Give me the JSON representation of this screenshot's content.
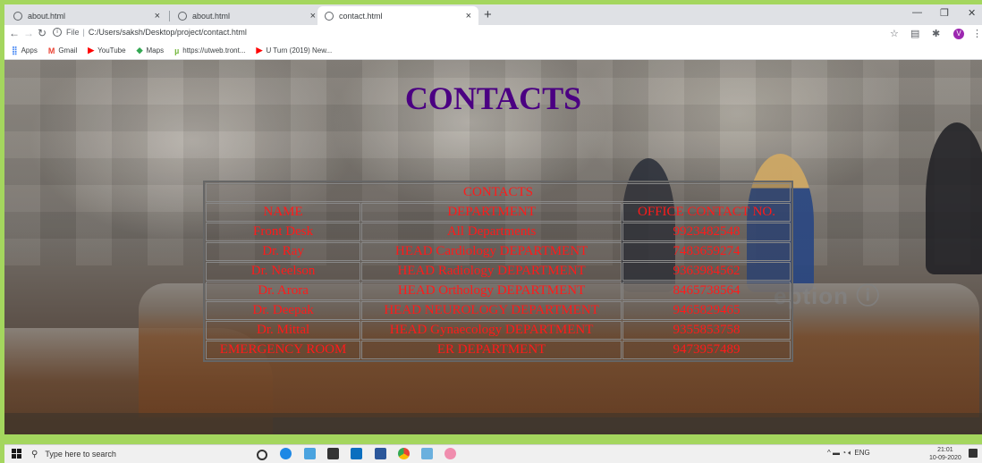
{
  "browser": {
    "tabs": [
      {
        "title": "about.html",
        "active": false
      },
      {
        "title": "about.html",
        "active": false
      },
      {
        "title": "contact.html",
        "active": true
      }
    ],
    "new_tab_symbol": "+",
    "close_symbol": "×",
    "address": {
      "scheme_label": "File",
      "url": "C:/Users/saksh/Desktop/project/contact.html"
    },
    "bookmarks": [
      {
        "label": "Apps",
        "icon": "apps-grid-icon",
        "color": "#4285f4"
      },
      {
        "label": "Gmail",
        "icon": "gmail-icon",
        "color": "#ea4335"
      },
      {
        "label": "YouTube",
        "icon": "youtube-icon",
        "color": "#ff0000"
      },
      {
        "label": "Maps",
        "icon": "maps-icon",
        "color": "#34a853"
      },
      {
        "label": "https://utweb.tront...",
        "icon": "utorrent-icon",
        "color": "#76b83f"
      },
      {
        "label": "U Turn (2019) New...",
        "icon": "youtube-icon",
        "color": "#ff0000"
      }
    ],
    "profile_initial": "V"
  },
  "page": {
    "title": "CONTACTS",
    "table": {
      "caption": "CONTACTS",
      "headers": [
        "NAME",
        "DEPARTMENT",
        "OFFICE CONTACT NO."
      ],
      "rows": [
        [
          "Front Desk",
          "All Departments",
          "9923482548"
        ],
        [
          "Dr. Ray",
          "HEAD Cardiology DEPARTMENT",
          "7483659274"
        ],
        [
          "Dr. Neelson",
          "HEAD Radiology DEPARTMENT",
          "9363984562"
        ],
        [
          "Dr. Arora",
          "HEAD Orthology DEPARTMENT",
          "8465738564"
        ],
        [
          "Dr. Deepak",
          "HEAD NEUROLOGY DEPARTMENT",
          "9465829465"
        ],
        [
          "Dr. Mittal",
          "HEAD Gynaecology DEPARTMENT",
          "9355853758"
        ],
        [
          "EMERGENCY ROOM",
          "ER DEPARTMENT",
          "9473957489"
        ]
      ],
      "text_color": "#ff1a1a"
    },
    "title_color": "#4b0082",
    "background_sign_text": "eption ⓘ"
  },
  "taskbar": {
    "search_placeholder": "Type here to search",
    "tray_language": "ENG",
    "time": "21:01",
    "date": "10-09-2020"
  }
}
